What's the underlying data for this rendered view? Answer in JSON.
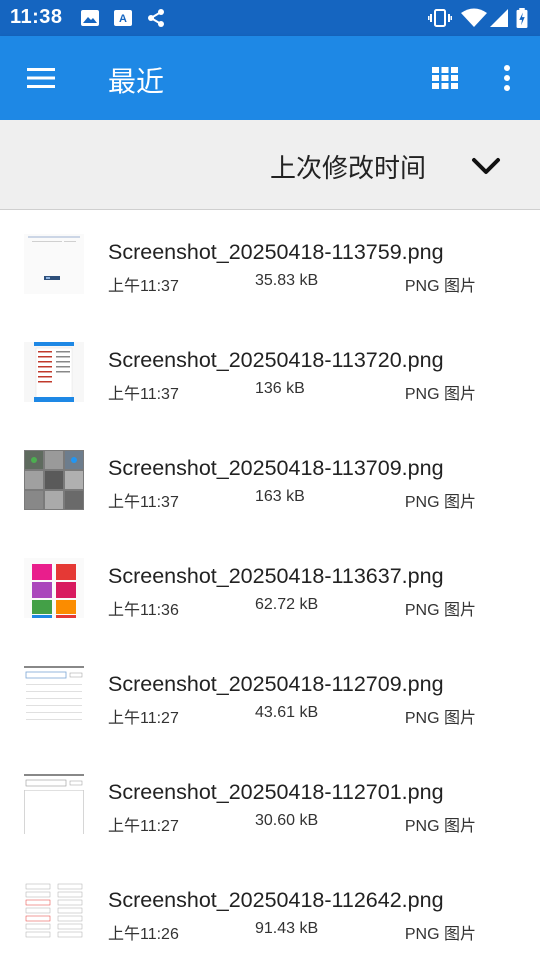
{
  "status_bar": {
    "time": "11:38",
    "left_icons": [
      "image-icon",
      "font-icon",
      "share-icon"
    ],
    "right_icons": [
      "vibrate-icon",
      "wifi-icon",
      "signal-icon",
      "battery-charging-icon"
    ]
  },
  "app_bar": {
    "title": "最近"
  },
  "sort": {
    "label": "上次修改时间"
  },
  "files": [
    {
      "name": "Screenshot_20250418-113759.png",
      "time": "上午11:37",
      "size": "35.83 kB",
      "type": "PNG 图片"
    },
    {
      "name": "Screenshot_20250418-113720.png",
      "time": "上午11:37",
      "size": "136 kB",
      "type": "PNG 图片"
    },
    {
      "name": "Screenshot_20250418-113709.png",
      "time": "上午11:37",
      "size": "163 kB",
      "type": "PNG 图片"
    },
    {
      "name": "Screenshot_20250418-113637.png",
      "time": "上午11:36",
      "size": "62.72 kB",
      "type": "PNG 图片"
    },
    {
      "name": "Screenshot_20250418-112709.png",
      "time": "上午11:27",
      "size": "43.61 kB",
      "type": "PNG 图片"
    },
    {
      "name": "Screenshot_20250418-112701.png",
      "time": "上午11:27",
      "size": "30.60 kB",
      "type": "PNG 图片"
    },
    {
      "name": "Screenshot_20250418-112642.png",
      "time": "上午11:26",
      "size": "91.43 kB",
      "type": "PNG 图片"
    }
  ],
  "colors": {
    "status_bar": "#1565c0",
    "app_bar": "#1e88e5",
    "sort_bar": "#efefef"
  }
}
